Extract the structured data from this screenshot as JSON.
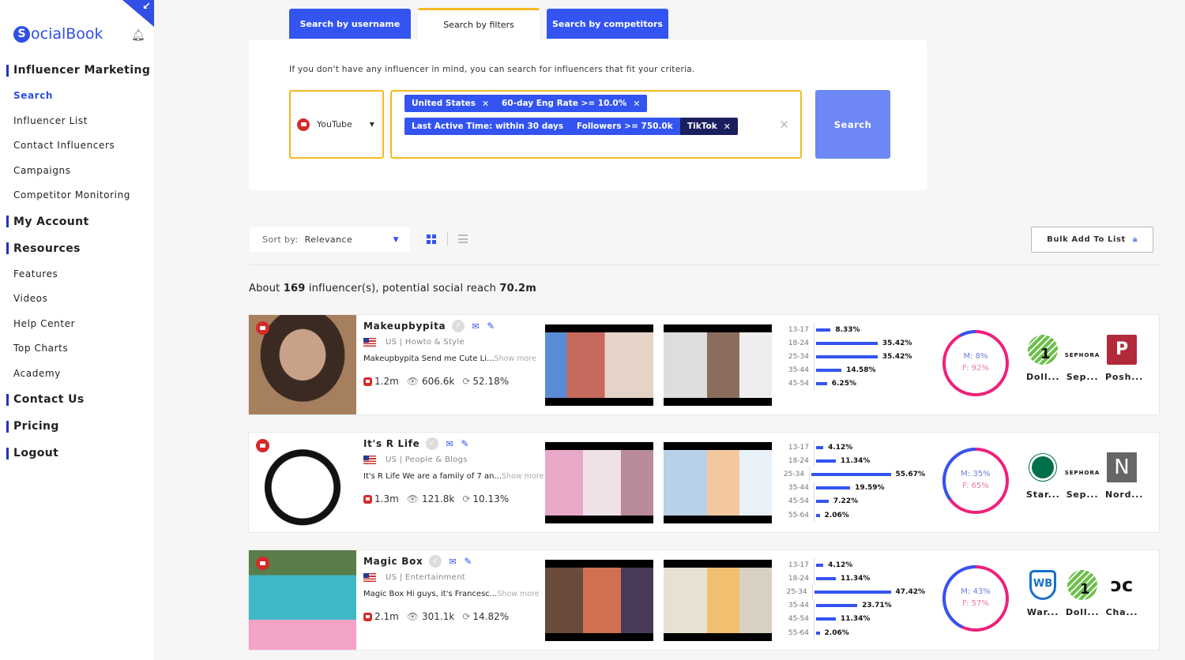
{
  "app": {
    "name": "SocialBook",
    "logo_letter": "S",
    "logo_rest": "ocialBook"
  },
  "sidebar": {
    "sections": [
      {
        "label": "Influencer Marketing",
        "items": [
          {
            "label": "Search",
            "active": true
          },
          {
            "label": "Influencer List"
          },
          {
            "label": "Contact Influencers"
          },
          {
            "label": "Campaigns"
          },
          {
            "label": "Competitor Monitoring"
          }
        ]
      },
      {
        "label": "My Account",
        "items": []
      },
      {
        "label": "Resources",
        "items": [
          {
            "label": "Features"
          },
          {
            "label": "Videos"
          },
          {
            "label": "Help Center"
          },
          {
            "label": "Top Charts"
          },
          {
            "label": "Academy"
          }
        ]
      },
      {
        "label": "Contact Us",
        "items": []
      },
      {
        "label": "Pricing",
        "items": []
      },
      {
        "label": "Logout",
        "items": []
      }
    ]
  },
  "tabs": [
    {
      "label": "Search by username",
      "active": false
    },
    {
      "label": "Search by filters",
      "active": true
    },
    {
      "label": "Search by competitors",
      "active": false
    }
  ],
  "search": {
    "hint": "If you don't have any influencer in mind, you can search for influencers that fit your criteria.",
    "platform": "YouTube",
    "filters": [
      {
        "label": "United States",
        "dark": false
      },
      {
        "label": "60-day Eng Rate >= 10.0%",
        "dark": false
      },
      {
        "label": "Last Active Time: within 30 days",
        "dark": false
      },
      {
        "label": "Followers >= 750.0k",
        "dark": false
      },
      {
        "label": "TikTok",
        "dark": true
      }
    ],
    "search_label": "Search"
  },
  "toolbar": {
    "sort_label": "Sort by:",
    "sort_value": "Relevance",
    "bulk_label": "Bulk Add To List"
  },
  "summary": {
    "prefix": "About",
    "count": "169",
    "middle": "influencer(s), potential social reach",
    "reach": "70.2m"
  },
  "colors": {
    "accent": "#3354f0",
    "highlight": "#f5b921",
    "male": "#3354f0",
    "female": "#f0207a",
    "youtube": "#d62a2a"
  },
  "influencers": [
    {
      "name": "Makeupbypita",
      "location": "US | Howto & Style",
      "bio": "Makeupbypita Send me Cute Li...",
      "show_more": "Show more",
      "subscribers": "1.2m",
      "views": "606.6k",
      "engagement": "52.18%",
      "ages": [
        {
          "range": "13-17",
          "value": 8.33,
          "label": "8.33%"
        },
        {
          "range": "18-24",
          "value": 35.42,
          "label": "35.42%"
        },
        {
          "range": "25-34",
          "value": 35.42,
          "label": "35.42%"
        },
        {
          "range": "35-44",
          "value": 14.58,
          "label": "14.58%"
        },
        {
          "range": "45-54",
          "value": 6.25,
          "label": "6.25%"
        }
      ],
      "gender": {
        "male": 8,
        "female": 92,
        "male_label": "M: 8%",
        "female_label": "F: 92%"
      },
      "brands": [
        {
          "name": "Doll...",
          "icon": "dollar-tree-logo"
        },
        {
          "name": "Sep...",
          "icon": "sephora-logo"
        },
        {
          "name": "Posh...",
          "icon": "poshmark-logo"
        }
      ]
    },
    {
      "name": "It's R Life",
      "location": "US | People & Blogs",
      "bio": "It's R Life We are a family of 7 an...",
      "show_more": "Show more",
      "subscribers": "1.3m",
      "views": "121.8k",
      "engagement": "10.13%",
      "ages": [
        {
          "range": "13-17",
          "value": 4.12,
          "label": "4.12%"
        },
        {
          "range": "18-24",
          "value": 11.34,
          "label": "11.34%"
        },
        {
          "range": "25-34",
          "value": 55.67,
          "label": "55.67%"
        },
        {
          "range": "35-44",
          "value": 19.59,
          "label": "19.59%"
        },
        {
          "range": "45-54",
          "value": 7.22,
          "label": "7.22%"
        },
        {
          "range": "55-64",
          "value": 2.06,
          "label": "2.06%"
        }
      ],
      "gender": {
        "male": 35,
        "female": 65,
        "male_label": "M: 35%",
        "female_label": "F: 65%"
      },
      "brands": [
        {
          "name": "Star...",
          "icon": "starbucks-logo"
        },
        {
          "name": "Sep...",
          "icon": "sephora-logo"
        },
        {
          "name": "Nord...",
          "icon": "nordstrom-logo"
        }
      ]
    },
    {
      "name": "Magic Box",
      "location": "US | Entertainment",
      "bio": "Magic Box Hi guys, it's Francesc...",
      "show_more": "Show more",
      "subscribers": "2.1m",
      "views": "301.1k",
      "engagement": "14.82%",
      "ages": [
        {
          "range": "13-17",
          "value": 4.12,
          "label": "4.12%"
        },
        {
          "range": "18-24",
          "value": 11.34,
          "label": "11.34%"
        },
        {
          "range": "25-34",
          "value": 47.42,
          "label": "47.42%"
        },
        {
          "range": "35-44",
          "value": 23.71,
          "label": "23.71%"
        },
        {
          "range": "45-54",
          "value": 11.34,
          "label": "11.34%"
        },
        {
          "range": "55-64",
          "value": 2.06,
          "label": "2.06%"
        }
      ],
      "gender": {
        "male": 43,
        "female": 57,
        "male_label": "M: 43%",
        "female_label": "F: 57%"
      },
      "brands": [
        {
          "name": "War...",
          "icon": "warner-bros-logo"
        },
        {
          "name": "Doll...",
          "icon": "dollar-tree-logo"
        },
        {
          "name": "Cha...",
          "icon": "chanel-logo"
        }
      ]
    }
  ]
}
